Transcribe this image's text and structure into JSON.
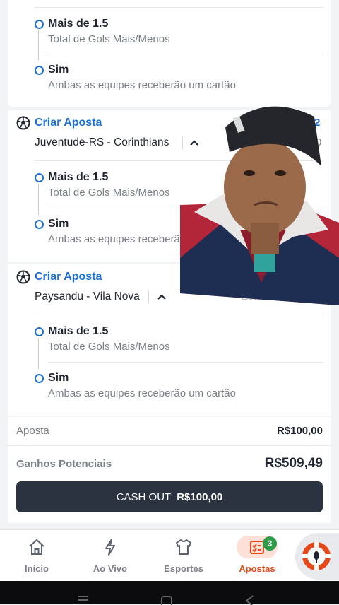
{
  "card1": {
    "selections": [
      {
        "title": "Mais de 1.5",
        "subtitle": "Total de Gols Mais/Menos"
      },
      {
        "title": "Sim",
        "subtitle": "Ambas as equipes receberão um cartão"
      }
    ]
  },
  "card2": {
    "header": "Criar Aposta",
    "match": "Juventude-RS - Corinthians",
    "odds_partial": "2",
    "odds_partial2": "0",
    "selections": [
      {
        "title": "Mais de 1.5",
        "subtitle": "Total de Gols Mais/Menos"
      },
      {
        "title": "Sim",
        "subtitle": "Ambas as equipes receberã"
      }
    ]
  },
  "card3": {
    "header": "Criar Aposta",
    "match": "Paysandu - Vila Nova",
    "faded_partial": "Este",
    "selections": [
      {
        "title": "Mais de 1.5",
        "subtitle": "Total de Gols Mais/Menos"
      },
      {
        "title": "Sim",
        "subtitle": "Ambas as equipes receberão um cartão"
      }
    ]
  },
  "summary": {
    "stake_label": "Aposta",
    "stake_value": "R$100,00",
    "potential_label": "Ganhos Potenciais",
    "potential_value": "R$509,49",
    "cashout_label": "CASH OUT",
    "cashout_value": "R$100,00"
  },
  "nav": {
    "items": [
      {
        "label": "Início",
        "icon": "home-icon"
      },
      {
        "label": "Ao Vivo",
        "icon": "lightning-icon"
      },
      {
        "label": "Esportes",
        "icon": "jersey-icon"
      },
      {
        "label": "Apostas",
        "icon": "betslip-icon",
        "badge": "3",
        "active": true
      }
    ]
  },
  "colors": {
    "accent": "#1f6fd1",
    "active": "#e5481a",
    "button": "#2b3240",
    "badge": "#2d9b4a"
  }
}
